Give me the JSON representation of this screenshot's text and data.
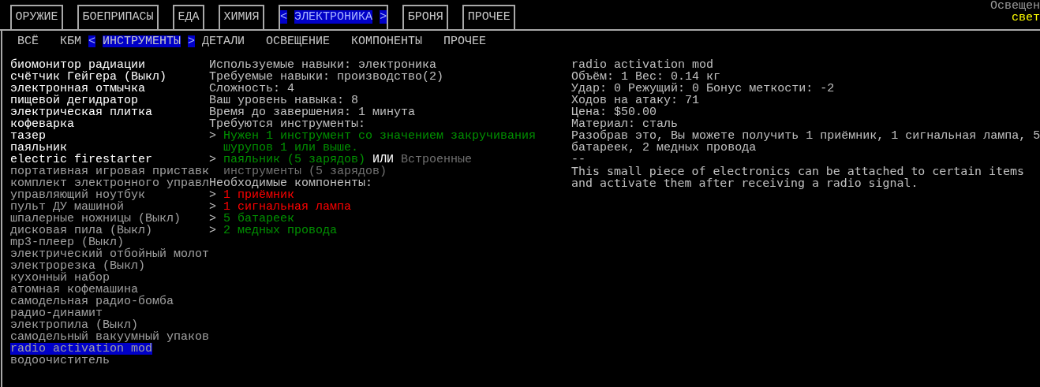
{
  "light": {
    "label": "Освещен",
    "value": "свет"
  },
  "categories": [
    {
      "label": "ОРУЖИЕ",
      "selected": false
    },
    {
      "label": "БОЕПРИПАСЫ",
      "selected": false
    },
    {
      "label": "ЕДА",
      "selected": false
    },
    {
      "label": "ХИМИЯ",
      "selected": false
    },
    {
      "label": "ЭЛЕКТРОНИКА",
      "selected": true
    },
    {
      "label": "БРОНЯ",
      "selected": false
    },
    {
      "label": "ПРОЧЕЕ",
      "selected": false
    }
  ],
  "tab_arrows": {
    "left": "<",
    "right": ">"
  },
  "subcategories": [
    {
      "label": "ВСЁ",
      "selected": false
    },
    {
      "label": "КБМ",
      "selected": false
    },
    {
      "label": "ИНСТРУМЕНТЫ",
      "selected": true
    },
    {
      "label": "ДЕТАЛИ",
      "selected": false
    },
    {
      "label": "ОСВЕЩЕНИЕ",
      "selected": false
    },
    {
      "label": "КОМПОНЕНТЫ",
      "selected": false
    },
    {
      "label": "ПРОЧЕЕ",
      "selected": false
    }
  ],
  "recipes": [
    {
      "name": "биомонитор радиации",
      "available": true,
      "selected": false
    },
    {
      "name": "счётчик Гейгера (Выкл)",
      "available": true,
      "selected": false
    },
    {
      "name": "электронная отмычка",
      "available": true,
      "selected": false
    },
    {
      "name": "пищевой дегидратор",
      "available": true,
      "selected": false
    },
    {
      "name": "электрическая плитка",
      "available": true,
      "selected": false
    },
    {
      "name": "кофеварка",
      "available": true,
      "selected": false
    },
    {
      "name": "тазер",
      "available": true,
      "selected": false
    },
    {
      "name": "паяльник",
      "available": true,
      "selected": false
    },
    {
      "name": "electric firestarter",
      "available": true,
      "selected": false
    },
    {
      "name": "портативная игровая приставк",
      "available": false,
      "selected": false
    },
    {
      "name": "комплект электронного управл",
      "available": false,
      "selected": false
    },
    {
      "name": "управляющий ноутбук",
      "available": false,
      "selected": false
    },
    {
      "name": "пульт ДУ машиной",
      "available": false,
      "selected": false
    },
    {
      "name": "шпалерные ножницы (Выкл)",
      "available": false,
      "selected": false
    },
    {
      "name": "дисковая пила (Выкл)",
      "available": false,
      "selected": false
    },
    {
      "name": "mp3-плеер (Выкл)",
      "available": false,
      "selected": false
    },
    {
      "name": "электрический отбойный молот",
      "available": false,
      "selected": false
    },
    {
      "name": "электрорезка (Выкл)",
      "available": false,
      "selected": false
    },
    {
      "name": "кухонный набор",
      "available": false,
      "selected": false
    },
    {
      "name": "атомная кофемашина",
      "available": false,
      "selected": false
    },
    {
      "name": "самодельная радио-бомба",
      "available": false,
      "selected": false
    },
    {
      "name": "радио-динамит",
      "available": false,
      "selected": false
    },
    {
      "name": "электропила (Выкл)",
      "available": false,
      "selected": false
    },
    {
      "name": "самодельный вакуумный упаков",
      "available": false,
      "selected": false
    },
    {
      "name": "radio activation mod",
      "available": false,
      "selected": true
    },
    {
      "name": "водоочиститель",
      "available": false,
      "selected": false
    }
  ],
  "recipe_info": {
    "lines": [
      "Используемые навыки: электроника",
      "Требуемые навыки: производство(2)",
      "Сложность: 4",
      "Ваш уровень навыка: 8",
      "Время до завершения: 1 минута"
    ],
    "tools_heading": "Требуются инструменты:",
    "tools": [
      {
        "bullet": ">",
        "options": [
          {
            "text": "Нужен 1 инструмент со значением закручивания шурупов 1 или выше.",
            "available": true
          }
        ]
      },
      {
        "bullet": ">",
        "or_word": "ИЛИ",
        "options": [
          {
            "text": "паяльник (5 зарядов)",
            "available": true
          },
          {
            "text": "Встроенные инструменты (5 зарядов)",
            "available": false
          }
        ]
      }
    ],
    "components_heading": "Необходимые компоненты:",
    "components": [
      {
        "bullet": ">",
        "text": "1 приёмник",
        "available": false
      },
      {
        "bullet": ">",
        "text": "1 сигнальная лампа",
        "available": false
      },
      {
        "bullet": ">",
        "text": "5 батареек",
        "available": true
      },
      {
        "bullet": ">",
        "text": "2 медных провода",
        "available": true
      }
    ]
  },
  "item_info": {
    "lines": [
      "radio activation mod",
      "Объём: 1 Вес: 0.14 кг",
      "Удар: 0 Режущий: 0 Бонус меткости: -2",
      "Ходов на атаку: 71",
      "Цена: $50.00",
      "Материал: сталь",
      "Разобрав это, Вы можете получить 1 приёмник, 1 сигнальная лампа, 5 батареек, 2 медных провода"
    ],
    "separator": "--",
    "description": "This small piece of electronics can be attached to certain items and activate them after receiving a radio signal."
  }
}
